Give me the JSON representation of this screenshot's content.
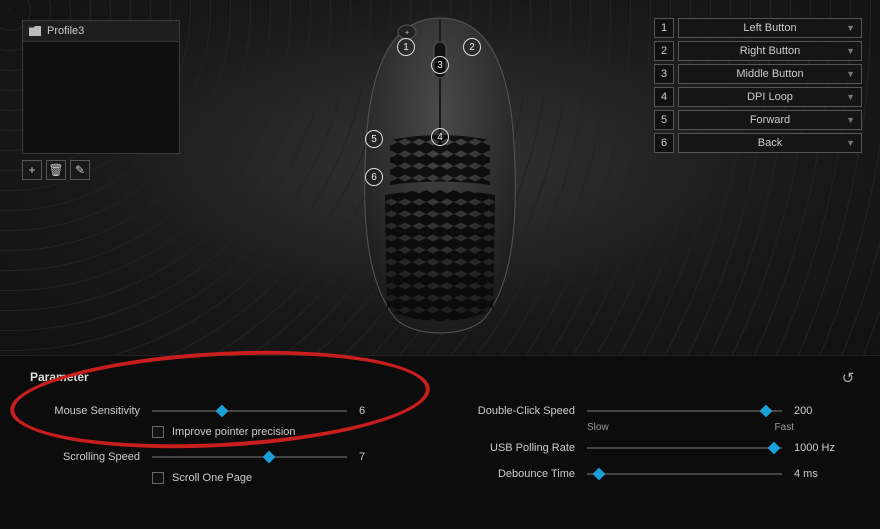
{
  "profile": {
    "name": "Profile3"
  },
  "tools": {
    "add": "+",
    "delete": "🗑",
    "edit": "✎"
  },
  "callouts": [
    "1",
    "2",
    "3",
    "4",
    "5",
    "6"
  ],
  "assignments": [
    {
      "num": "1",
      "label": "Left Button"
    },
    {
      "num": "2",
      "label": "Right Button"
    },
    {
      "num": "3",
      "label": "Middle Button"
    },
    {
      "num": "4",
      "label": "DPI Loop"
    },
    {
      "num": "5",
      "label": "Forward"
    },
    {
      "num": "6",
      "label": "Back"
    }
  ],
  "panel": {
    "title": "Parameter",
    "mouse_sensitivity": {
      "label": "Mouse Sensitivity",
      "value": "6",
      "pct": 36
    },
    "improve_precision": {
      "label": "Improve pointer precision"
    },
    "scrolling_speed": {
      "label": "Scrolling Speed",
      "value": "7",
      "pct": 60
    },
    "scroll_one_page": {
      "label": "Scroll One Page"
    },
    "double_click": {
      "label": "Double-Click Speed",
      "value": "200",
      "pct": 92,
      "low": "Slow",
      "high": "Fast"
    },
    "polling": {
      "label": "USB Polling Rate",
      "value": "1000 Hz",
      "pct": 96
    },
    "debounce": {
      "label": "Debounce Time",
      "value": "4 ms",
      "pct": 6
    }
  }
}
